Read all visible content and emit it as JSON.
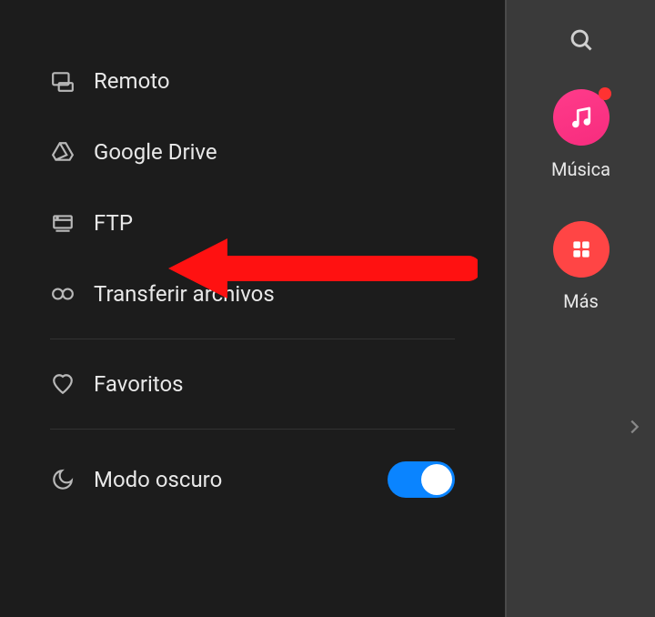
{
  "sidebar": {
    "items": [
      {
        "label": "Remoto",
        "icon": "remote"
      },
      {
        "label": "Google Drive",
        "icon": "drive"
      },
      {
        "label": "FTP",
        "icon": "ftp"
      },
      {
        "label": "Transferir archivos",
        "icon": "transfer"
      },
      {
        "label": "Favoritos",
        "icon": "heart"
      }
    ],
    "dark_mode": {
      "label": "Modo oscuro",
      "enabled": true
    }
  },
  "right_panel": {
    "tiles": [
      {
        "label": "Música",
        "has_badge": true
      },
      {
        "label": "Más",
        "has_badge": false
      }
    ]
  },
  "annotation": {
    "type": "arrow",
    "target": "ftp",
    "color": "#ff0000"
  }
}
